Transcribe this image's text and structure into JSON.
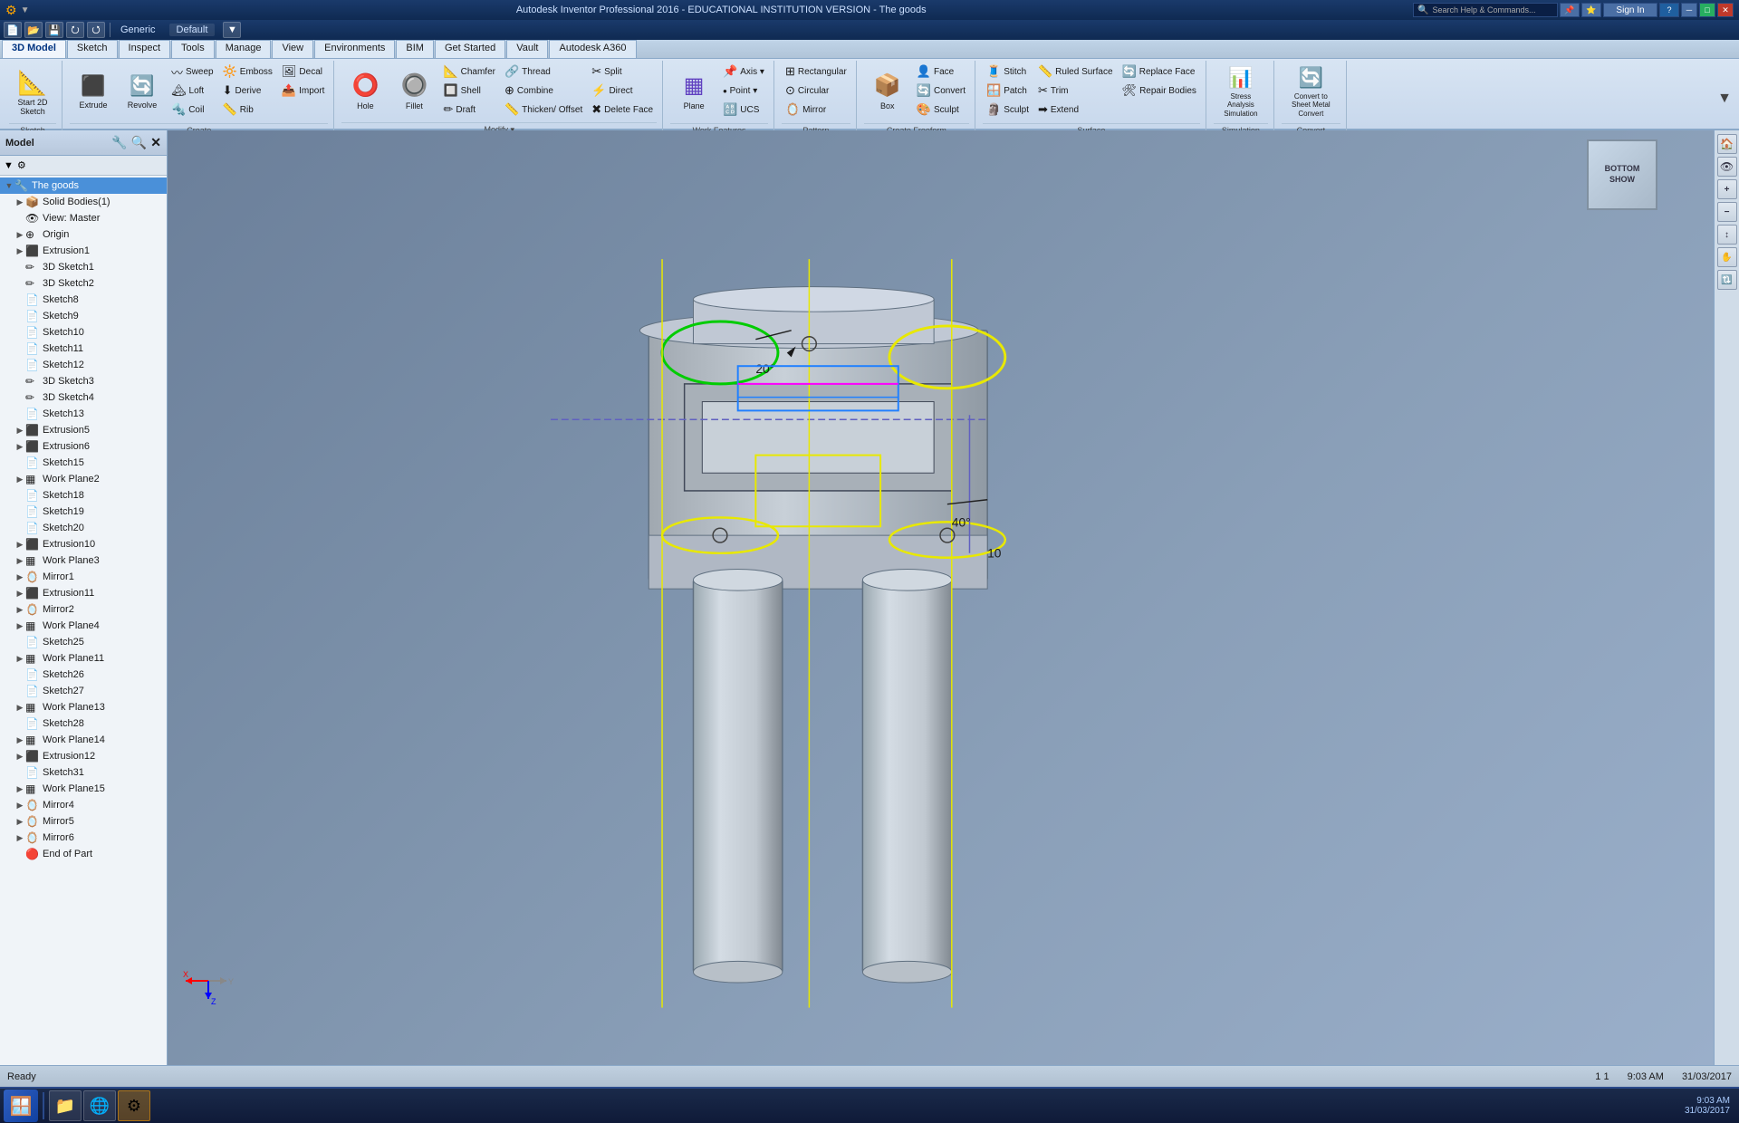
{
  "app": {
    "title": "Autodesk Inventor Professional 2016 - EDUCATIONAL INSTITUTION VERSION - The goods",
    "file_title": "The goods",
    "search_placeholder": "Search Help & Commands..."
  },
  "titlebar": {
    "minimize": "─",
    "maximize": "□",
    "close": "✕",
    "restore": "❐"
  },
  "quick_access": {
    "items": [
      "⭮",
      "⭯",
      "💾",
      "▶"
    ],
    "profile": "Generic",
    "project": "Default"
  },
  "tabs": [
    {
      "label": "3D Model",
      "active": true
    },
    {
      "label": "Sketch"
    },
    {
      "label": "Inspect"
    },
    {
      "label": "Tools"
    },
    {
      "label": "Manage"
    },
    {
      "label": "View"
    },
    {
      "label": "Environments"
    },
    {
      "label": "BIM"
    },
    {
      "label": "Get Started"
    },
    {
      "label": "Vault"
    },
    {
      "label": "Autodesk A360"
    }
  ],
  "ribbon": {
    "groups": [
      {
        "name": "Sketch",
        "label": "Sketch",
        "items_large": [
          {
            "icon": "📐",
            "label": "Start\n2D Sketch"
          }
        ],
        "items_small": []
      },
      {
        "name": "Create",
        "label": "Create",
        "cols": [
          [
            {
              "icon": "⬛",
              "label": "Extrude"
            },
            {
              "icon": "🔄",
              "label": "Revolve"
            }
          ],
          [
            {
              "icon": "〰",
              "label": "Sweep"
            },
            {
              "icon": "⬆",
              "label": "Loft"
            },
            {
              "icon": "🔩",
              "label": "Coil"
            }
          ],
          [
            {
              "icon": "🗿",
              "label": "Emboss"
            },
            {
              "icon": "⬇",
              "label": "Derive"
            },
            {
              "icon": "📥",
              "label": "Rib"
            }
          ],
          [
            {
              "icon": "🖼",
              "label": "Decal"
            },
            {
              "icon": "📤",
              "label": "Import"
            }
          ]
        ]
      },
      {
        "name": "Modify",
        "label": "Modify ▾",
        "cols": [
          [
            {
              "icon": "⭕",
              "label": "Hole"
            },
            {
              "icon": "🔘",
              "label": "Fillet"
            }
          ],
          [
            {
              "icon": "📐",
              "label": "Chamfer"
            },
            {
              "icon": "🔗",
              "label": "Shell"
            },
            {
              "icon": "✏",
              "label": "Draft"
            }
          ],
          [
            {
              "icon": "🔄",
              "label": "Thread"
            },
            {
              "icon": "🔲",
              "label": "Combine"
            },
            {
              "icon": "📏",
              "label": "Thicken/ Offset"
            }
          ],
          [
            {
              "icon": "✂",
              "label": "Split"
            },
            {
              "icon": "⚡",
              "label": "Direct"
            },
            {
              "icon": "✖",
              "label": "Delete Face"
            }
          ]
        ]
      },
      {
        "name": "Work Features",
        "label": "Work Features",
        "items_large": [
          {
            "icon": "▦",
            "label": "Plane"
          }
        ],
        "cols": [
          [
            {
              "icon": "📌",
              "label": "Axis ▾"
            },
            {
              "icon": "•",
              "label": "Point ▾"
            },
            {
              "icon": "🔠",
              "label": "UCS"
            }
          ]
        ]
      },
      {
        "name": "Pattern",
        "label": "Pattern",
        "cols": [
          [
            {
              "icon": "⊞",
              "label": "Rectangular"
            },
            {
              "icon": "⊙",
              "label": "Circular"
            },
            {
              "icon": "🪞",
              "label": "Mirror"
            }
          ]
        ]
      },
      {
        "name": "Create Freeform",
        "label": "Create Freeform",
        "items_large": [
          {
            "icon": "📦",
            "label": "Box"
          }
        ],
        "cols": [
          [
            {
              "icon": "👤",
              "label": "Face"
            },
            {
              "icon": "🔄",
              "label": "Convert"
            },
            {
              "icon": "🎨",
              "label": "Sculpt"
            }
          ]
        ]
      },
      {
        "name": "Surface",
        "label": "Surface",
        "cols": [
          [
            {
              "icon": "🧵",
              "label": "Stitch"
            },
            {
              "icon": "🪟",
              "label": "Patch"
            },
            {
              "icon": "🗿",
              "label": "Sculpt"
            }
          ],
          [
            {
              "icon": "📏",
              "label": "Ruled Surface"
            },
            {
              "icon": "✂",
              "label": "Trim"
            },
            {
              "icon": "➡",
              "label": "Extend"
            }
          ],
          [
            {
              "icon": "🔄",
              "label": "Replace Face"
            },
            {
              "icon": "🛠",
              "label": "Repair Bodies"
            }
          ]
        ]
      },
      {
        "name": "Simulation",
        "label": "Simulation",
        "items_large": [
          {
            "icon": "📊",
            "label": "Stress\nAnalysis\nSimulation"
          }
        ]
      },
      {
        "name": "Convert",
        "label": "Convert",
        "items_large": [
          {
            "icon": "🔄",
            "label": "Convert to\nSheet Metal\nConvert"
          }
        ]
      }
    ]
  },
  "sidebar": {
    "title": "Model",
    "tree": [
      {
        "id": "root",
        "label": "The goods",
        "icon": "🔧",
        "indent": 0,
        "expand": "▼"
      },
      {
        "id": "solid-bodies",
        "label": "Solid Bodies(1)",
        "icon": "📦",
        "indent": 1,
        "expand": "▶"
      },
      {
        "id": "view-master",
        "label": "View: Master",
        "icon": "👁",
        "indent": 1,
        "expand": ""
      },
      {
        "id": "origin",
        "label": "Origin",
        "icon": "⊕",
        "indent": 1,
        "expand": "▶"
      },
      {
        "id": "extrusion1",
        "label": "Extrusion1",
        "icon": "⬛",
        "indent": 1,
        "expand": "▶"
      },
      {
        "id": "sketch3d1",
        "label": "3D Sketch1",
        "icon": "✏",
        "indent": 1,
        "expand": ""
      },
      {
        "id": "sketch3d2",
        "label": "3D Sketch2",
        "icon": "✏",
        "indent": 1,
        "expand": ""
      },
      {
        "id": "sketch8",
        "label": "Sketch8",
        "icon": "📄",
        "indent": 1,
        "expand": ""
      },
      {
        "id": "sketch9",
        "label": "Sketch9",
        "icon": "📄",
        "indent": 1,
        "expand": ""
      },
      {
        "id": "sketch10",
        "label": "Sketch10",
        "icon": "📄",
        "indent": 1,
        "expand": ""
      },
      {
        "id": "sketch11",
        "label": "Sketch11",
        "icon": "📄",
        "indent": 1,
        "expand": ""
      },
      {
        "id": "sketch12",
        "label": "Sketch12",
        "icon": "📄",
        "indent": 1,
        "expand": ""
      },
      {
        "id": "sketch3d3",
        "label": "3D Sketch3",
        "icon": "✏",
        "indent": 1,
        "expand": ""
      },
      {
        "id": "sketch3d4",
        "label": "3D Sketch4",
        "icon": "✏",
        "indent": 1,
        "expand": ""
      },
      {
        "id": "sketch13",
        "label": "Sketch13",
        "icon": "📄",
        "indent": 1,
        "expand": ""
      },
      {
        "id": "extrusion5",
        "label": "Extrusion5",
        "icon": "⬛",
        "indent": 1,
        "expand": "▶"
      },
      {
        "id": "extrusion6",
        "label": "Extrusion6",
        "icon": "⬛",
        "indent": 1,
        "expand": "▶"
      },
      {
        "id": "sketch15",
        "label": "Sketch15",
        "icon": "📄",
        "indent": 1,
        "expand": ""
      },
      {
        "id": "workplane2",
        "label": "Work Plane2",
        "icon": "▦",
        "indent": 1,
        "expand": "▶"
      },
      {
        "id": "sketch18",
        "label": "Sketch18",
        "icon": "📄",
        "indent": 1,
        "expand": ""
      },
      {
        "id": "sketch19",
        "label": "Sketch19",
        "icon": "📄",
        "indent": 1,
        "expand": ""
      },
      {
        "id": "sketch20",
        "label": "Sketch20",
        "icon": "📄",
        "indent": 1,
        "expand": ""
      },
      {
        "id": "extrusion10",
        "label": "Extrusion10",
        "icon": "⬛",
        "indent": 1,
        "expand": "▶"
      },
      {
        "id": "workplane3",
        "label": "Work Plane3",
        "icon": "▦",
        "indent": 1,
        "expand": "▶"
      },
      {
        "id": "mirror1",
        "label": "Mirror1",
        "icon": "🪞",
        "indent": 1,
        "expand": "▶"
      },
      {
        "id": "extrusion11",
        "label": "Extrusion11",
        "icon": "⬛",
        "indent": 1,
        "expand": "▶"
      },
      {
        "id": "mirror2",
        "label": "Mirror2",
        "icon": "🪞",
        "indent": 1,
        "expand": "▶"
      },
      {
        "id": "workplane4",
        "label": "Work Plane4",
        "icon": "▦",
        "indent": 1,
        "expand": "▶"
      },
      {
        "id": "sketch25",
        "label": "Sketch25",
        "icon": "📄",
        "indent": 1,
        "expand": ""
      },
      {
        "id": "workplane11",
        "label": "Work Plane11",
        "icon": "▦",
        "indent": 1,
        "expand": "▶"
      },
      {
        "id": "sketch26",
        "label": "Sketch26",
        "icon": "📄",
        "indent": 1,
        "expand": ""
      },
      {
        "id": "sketch27",
        "label": "Sketch27",
        "icon": "📄",
        "indent": 1,
        "expand": ""
      },
      {
        "id": "workplane13",
        "label": "Work Plane13",
        "icon": "▦",
        "indent": 1,
        "expand": "▶"
      },
      {
        "id": "sketch28",
        "label": "Sketch28",
        "icon": "📄",
        "indent": 1,
        "expand": ""
      },
      {
        "id": "workplane14",
        "label": "Work Plane14",
        "icon": "▦",
        "indent": 1,
        "expand": "▶"
      },
      {
        "id": "extrusion12",
        "label": "Extrusion12",
        "icon": "⬛",
        "indent": 1,
        "expand": "▶"
      },
      {
        "id": "sketch31",
        "label": "Sketch31",
        "icon": "📄",
        "indent": 1,
        "expand": ""
      },
      {
        "id": "workplane15",
        "label": "Work Plane15",
        "icon": "▦",
        "indent": 1,
        "expand": "▶"
      },
      {
        "id": "mirror4",
        "label": "Mirror4",
        "icon": "🪞",
        "indent": 1,
        "expand": "▶"
      },
      {
        "id": "mirror5",
        "label": "Mirror5",
        "icon": "🪞",
        "indent": 1,
        "expand": "▶"
      },
      {
        "id": "mirror6",
        "label": "Mirror6",
        "icon": "🪞",
        "indent": 1,
        "expand": "▶"
      },
      {
        "id": "end-of-part",
        "label": "End of Part",
        "icon": "🔴",
        "indent": 1,
        "expand": ""
      }
    ]
  },
  "status": {
    "text": "Ready",
    "page": "1",
    "of": "1",
    "time": "9:03 AM",
    "date": "31/03/2017"
  },
  "viewport": {
    "nav_label": "BOTTOM\nSHOW",
    "coord_label": "20°",
    "dim1": "40°",
    "dim2": "10"
  },
  "right_panel": {
    "icons": [
      "🏠",
      "👁",
      "⬆",
      "⬇",
      "↕"
    ]
  }
}
